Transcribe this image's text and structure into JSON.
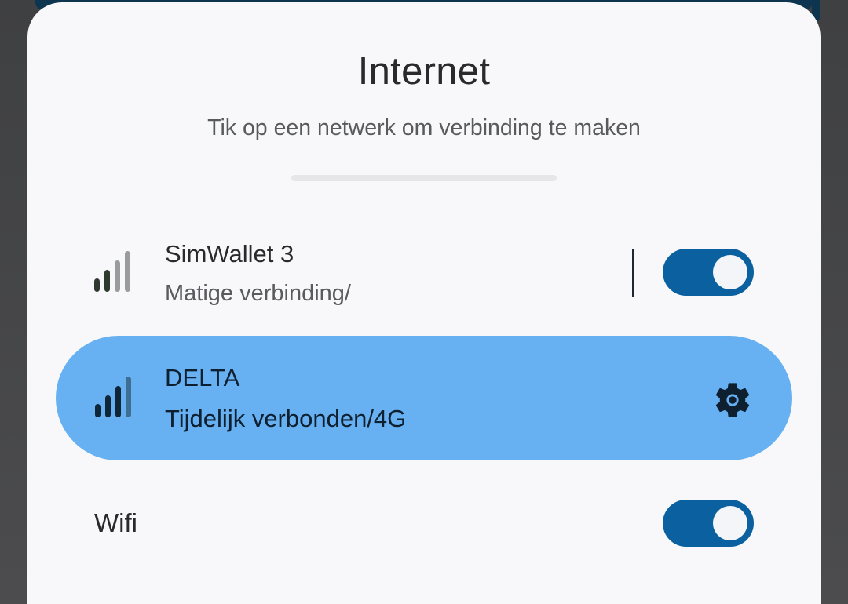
{
  "sheet": {
    "title": "Internet",
    "subtitle": "Tik op een netwerk om verbinding te maken"
  },
  "networks": [
    {
      "name": "SimWallet 3",
      "status": "Matige verbinding/",
      "signal_icon": "signal-bars-icon",
      "signal_bars_filled": 2,
      "toggle_on": true
    },
    {
      "name": "DELTA",
      "status": "Tijdelijk verbonden/4G",
      "signal_icon": "signal-bars-icon",
      "signal_bars_filled": 3,
      "action_icon": "gear-icon",
      "selected": true
    }
  ],
  "wifi": {
    "label": "Wifi",
    "toggle_on": true
  },
  "colors": {
    "sheet_bg": "#f8f8fa",
    "accent_toggle": "#0b619f",
    "selected_row": "#67b1f2",
    "backdrop": "#4a4a4c"
  }
}
